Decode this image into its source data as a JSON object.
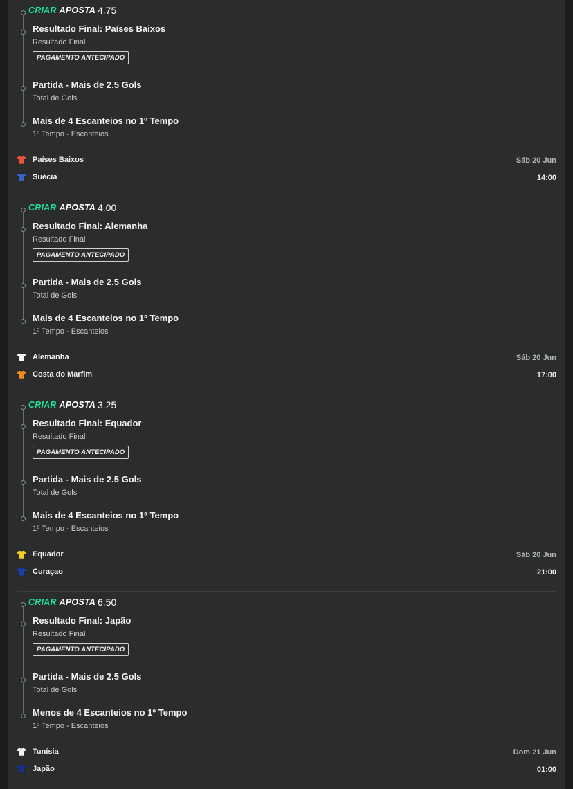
{
  "brand": {
    "criar": "CRIAR",
    "aposta": "APOSTA"
  },
  "bets": [
    {
      "odds": "4.75",
      "selections": [
        {
          "title": "Resultado Final: Países Baixos",
          "market": "Resultado Final",
          "badge": "PAGAMENTO ANTECIPADO"
        },
        {
          "title": "Partida - Mais de 2.5 Gols",
          "market": "Total de Gols"
        },
        {
          "title": "Mais de 4 Escanteios no 1º Tempo",
          "market": "1º Tempo - Escanteios"
        }
      ],
      "home": {
        "name": "Países Baixos",
        "jersey": "#e8553a",
        "icon": "jersey-icon"
      },
      "away": {
        "name": "Suécia",
        "jersey": "#3563c9",
        "icon": "jersey-icon"
      },
      "date": "Sáb 20 Jun",
      "time": "14:00"
    },
    {
      "odds": "4.00",
      "selections": [
        {
          "title": "Resultado Final: Alemanha",
          "market": "Resultado Final",
          "badge": "PAGAMENTO ANTECIPADO"
        },
        {
          "title": "Partida - Mais de 2.5 Gols",
          "market": "Total de Gols"
        },
        {
          "title": "Mais de 4 Escanteios no 1º Tempo",
          "market": "1º Tempo - Escanteios"
        }
      ],
      "home": {
        "name": "Alemanha",
        "jersey": "#f4f4f4",
        "icon": "jersey-icon"
      },
      "away": {
        "name": "Costa do Marfim",
        "jersey": "#f08a24",
        "icon": "jersey-icon"
      },
      "date": "Sáb 20 Jun",
      "time": "17:00"
    },
    {
      "odds": "3.25",
      "selections": [
        {
          "title": "Resultado Final: Equador",
          "market": "Resultado Final",
          "badge": "PAGAMENTO ANTECIPADO"
        },
        {
          "title": "Partida - Mais de 2.5 Gols",
          "market": "Total de Gols"
        },
        {
          "title": "Mais de 4 Escanteios no 1º Tempo",
          "market": "1º Tempo - Escanteios"
        }
      ],
      "home": {
        "name": "Equador",
        "jersey": "#f3cd1f",
        "icon": "jersey-icon"
      },
      "away": {
        "name": "Curaçao",
        "jersey": "#1f3fa8",
        "icon": "jersey-icon"
      },
      "date": "Sáb 20 Jun",
      "time": "21:00"
    },
    {
      "odds": "6.50",
      "selections": [
        {
          "title": "Resultado Final: Japão",
          "market": "Resultado Final",
          "badge": "PAGAMENTO ANTECIPADO"
        },
        {
          "title": "Partida - Mais de 2.5 Gols",
          "market": "Total de Gols"
        },
        {
          "title": "Menos de 4 Escanteios no 1º Tempo",
          "market": "1º Tempo - Escanteios"
        }
      ],
      "home": {
        "name": "Tunísia",
        "jersey": "#f4f4f4",
        "icon": "jersey-icon"
      },
      "away": {
        "name": "Japão",
        "jersey": "#1b2f8a",
        "icon": "jersey-icon"
      },
      "date": "Dom 21 Jun",
      "time": "01:00"
    }
  ]
}
